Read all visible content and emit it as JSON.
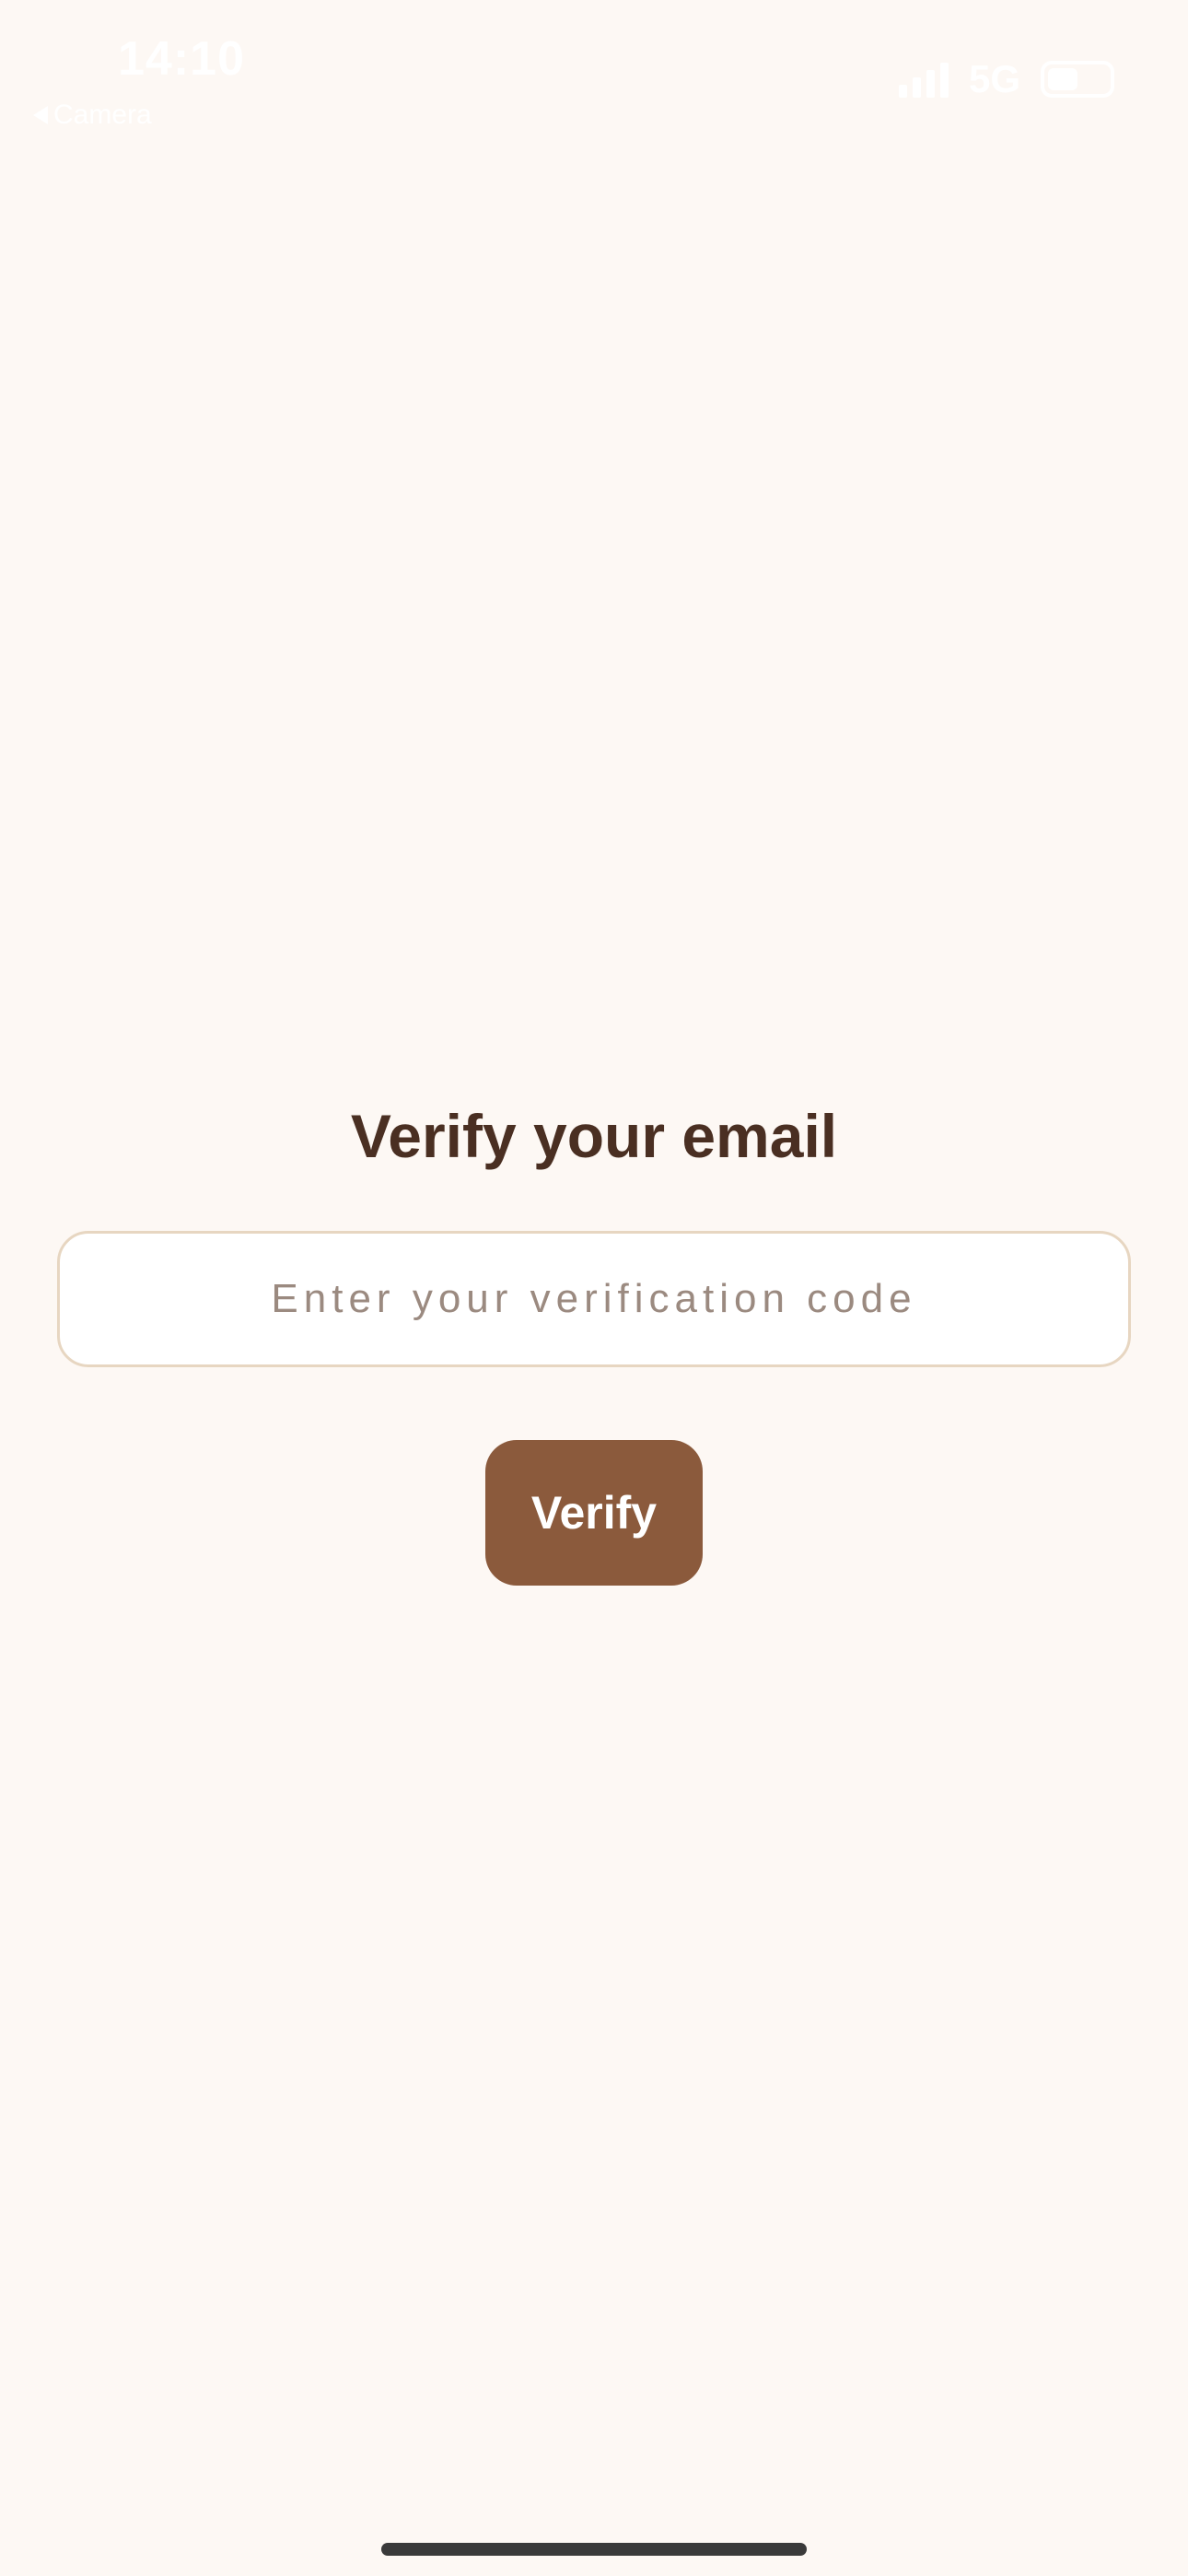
{
  "status_bar": {
    "time": "14:10",
    "back_label": "Camera",
    "network": "5G",
    "signal_icon": "signal-bars-icon",
    "battery_icon": "battery-icon"
  },
  "verify": {
    "title": "Verify your email",
    "code_placeholder": "Enter your verification code",
    "code_value": "",
    "button_label": "Verify"
  },
  "colors": {
    "background": "#fdf8f4",
    "title": "#4a2f22",
    "input_border": "#e7d6c1",
    "placeholder": "#9b8a80",
    "button": "#8b5a3c",
    "button_text": "#ffffff"
  }
}
